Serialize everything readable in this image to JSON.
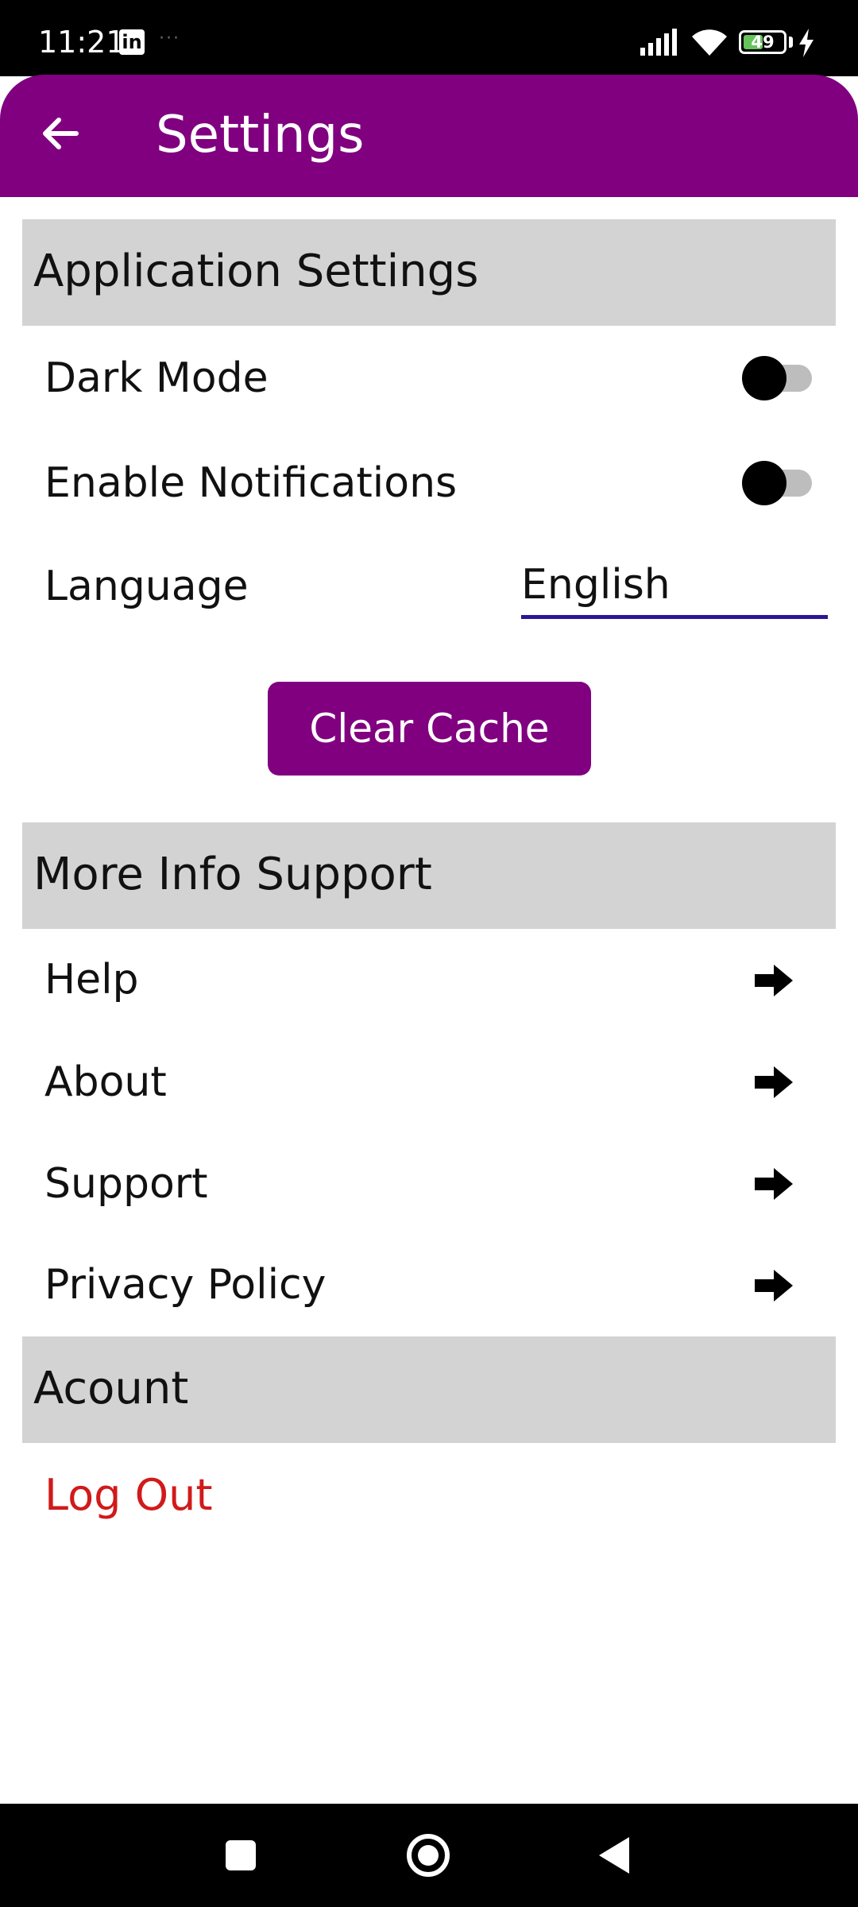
{
  "status_bar": {
    "time": "11:21",
    "app_badge": "in",
    "more_dots": "···",
    "battery_level": "49"
  },
  "header": {
    "title": "Settings",
    "color": "#800080"
  },
  "sections": {
    "application": {
      "title": "Application Settings",
      "dark_mode_label": "Dark Mode",
      "dark_mode_on": false,
      "notifications_label": "Enable Notifications",
      "notifications_on": false,
      "language_label": "Language",
      "language_value": "English",
      "clear_cache_label": "Clear Cache"
    },
    "more_info": {
      "title": "More Info Support",
      "items": [
        {
          "label": "Help"
        },
        {
          "label": "About"
        },
        {
          "label": "Support"
        },
        {
          "label": "Privacy Policy"
        }
      ]
    },
    "account": {
      "title": "Acount",
      "logout_label": "Log Out",
      "logout_color": "#d11a1a"
    }
  }
}
